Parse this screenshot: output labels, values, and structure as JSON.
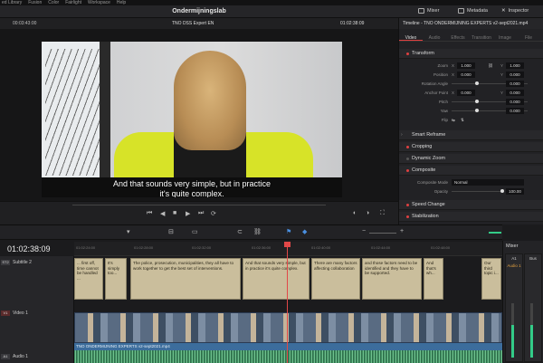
{
  "menu": [
    "ed Library",
    "Fusion",
    "Color",
    "Fairlight",
    "Workspace",
    "Help"
  ],
  "titlebar": {
    "project": "Ondermijningslab",
    "mixer": "Mixer",
    "metadata": "Metadata",
    "inspector": "Inspector"
  },
  "viewer": {
    "timecode_left": "00:03:43:00",
    "clip_name": "TNO DSS Expert EN",
    "timecode_right": "01:02:38:09",
    "subtitle_line1": "And that sounds very simple, but in practice",
    "subtitle_line2": "it's quite complex."
  },
  "inspector": {
    "header": "Timeline - TNO ONDERMIJNING EXPERTS v2-sept2021.mp4",
    "tabs": [
      "Video",
      "Audio",
      "Effects",
      "Transition",
      "Image",
      "File"
    ],
    "transform_label": "Transform",
    "zoom": {
      "label": "Zoom",
      "x": "1.000",
      "y": "1.000"
    },
    "position": {
      "label": "Position",
      "x": "0.000",
      "y": "0.000"
    },
    "rotation": {
      "label": "Rotation Angle",
      "v": "0.000"
    },
    "anchor": {
      "label": "Anchor Point",
      "x": "0.000",
      "y": "0.000"
    },
    "pitch": {
      "label": "Pitch",
      "v": "0.000"
    },
    "yaw": {
      "label": "Yaw",
      "v": "0.000"
    },
    "flip": {
      "label": "Flip"
    },
    "sections": [
      "Smart Reframe",
      "Cropping",
      "Dynamic Zoom",
      "Composite",
      "Speed Change",
      "Stabilization"
    ],
    "composite_mode": {
      "label": "Composite Mode",
      "v": "Normal"
    },
    "opacity": {
      "label": "Opacity",
      "v": "100.00"
    }
  },
  "timeline": {
    "timecode": "01:02:38:09",
    "ruler": [
      "01:02:24:00",
      "01:02:28:00",
      "01:02:32:00",
      "01:02:36:00",
      "01:02:40:00",
      "01:02:44:00",
      "01:02:48:00"
    ],
    "tracks": {
      "subtitle": "Subtitle 2",
      "video": "Video 1",
      "audio": "Audio 1",
      "s_badge": "ST2",
      "v_badge": "V1",
      "a_badge": "A1"
    },
    "subtitle_clips": [
      "... first off, time cannot be handled ...",
      "It's simply too...",
      "The police, prosecution, municipalities, they all have to work together to get the best set of interventions.",
      "And that sounds very simple, but in practice it's quite complex.",
      "There are many factors affecting collaboration",
      "and those factors need to be identified and they have to be supported.",
      "And that's wh...",
      "Our third topic i..."
    ],
    "video_clip_name": "TNO ONDERMIJNING EXPERTS v2-sept2021.mp4"
  },
  "mixer": {
    "title": "Mixer",
    "ch1": "A1",
    "ch2": "Bus",
    "ch1_name": "Audio 1"
  }
}
